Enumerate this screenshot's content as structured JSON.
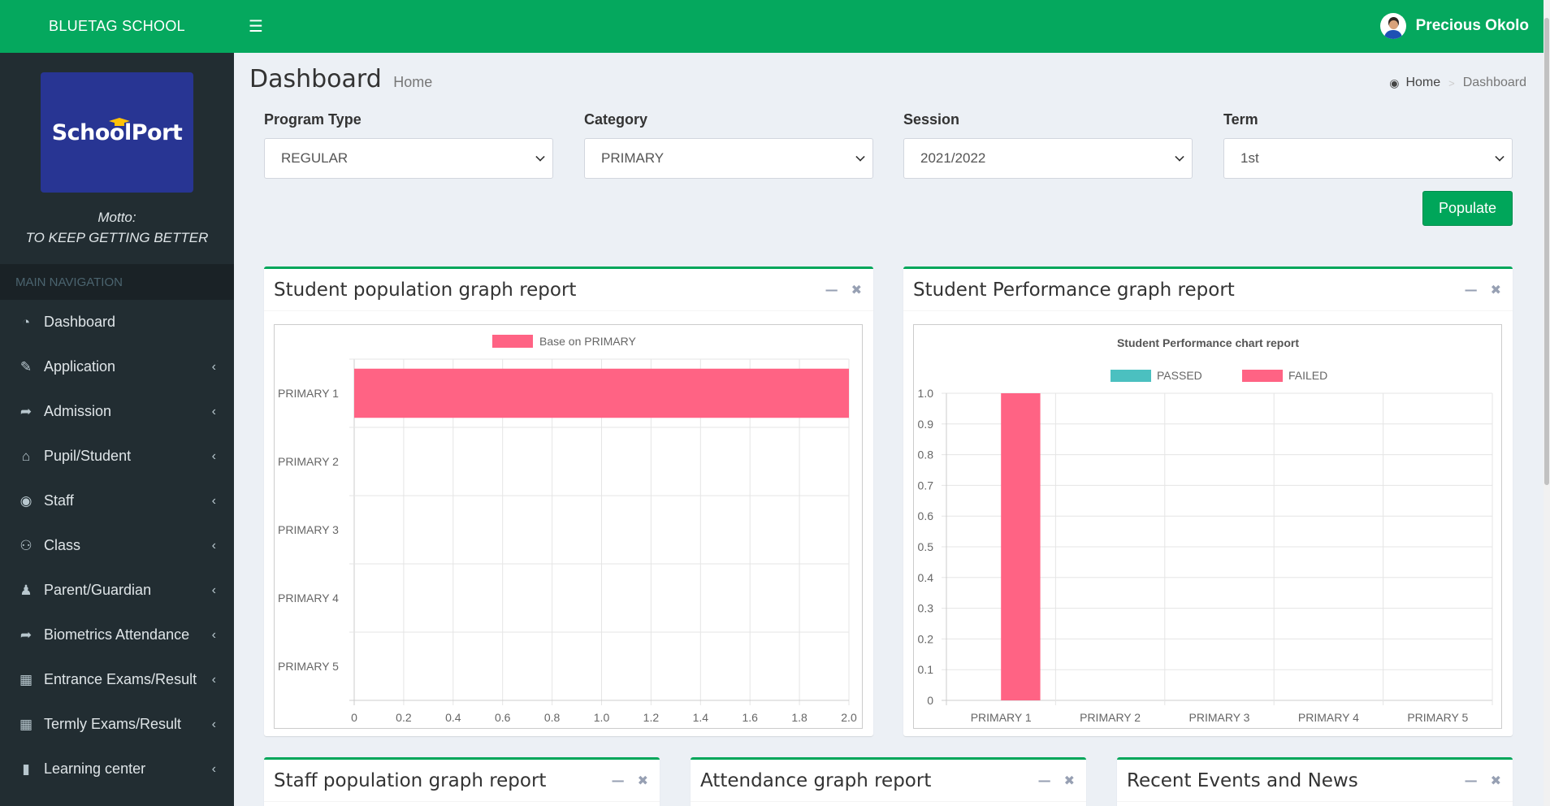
{
  "app": {
    "brand": "BLUETAG SCHOOL",
    "logo_text": "SchoolPort",
    "motto_label": "Motto:",
    "motto": "TO KEEP GETTING BETTER"
  },
  "header": {
    "user_name": "Precious Okolo"
  },
  "sidebar": {
    "section_title": "MAIN NAVIGATION",
    "items": [
      {
        "label": "Dashboard",
        "icon": "dashboard-icon",
        "expandable": false
      },
      {
        "label": "Application",
        "icon": "edit-icon",
        "expandable": true
      },
      {
        "label": "Admission",
        "icon": "share-icon",
        "expandable": true
      },
      {
        "label": "Pupil/Student",
        "icon": "graduation-cap-icon",
        "expandable": true
      },
      {
        "label": "Staff",
        "icon": "user-circle-icon",
        "expandable": true
      },
      {
        "label": "Class",
        "icon": "users-icon",
        "expandable": true
      },
      {
        "label": "Parent/Guardian",
        "icon": "user-icon",
        "expandable": true
      },
      {
        "label": "Biometrics Attendance",
        "icon": "share-icon",
        "expandable": true
      },
      {
        "label": "Entrance Exams/Result",
        "icon": "table-icon",
        "expandable": true
      },
      {
        "label": "Termly Exams/Result",
        "icon": "table-icon",
        "expandable": true
      },
      {
        "label": "Learning center",
        "icon": "book-icon",
        "expandable": true
      }
    ]
  },
  "page": {
    "title": "Dashboard",
    "subtitle": "Home",
    "breadcrumb": {
      "home": "Home",
      "current": "Dashboard"
    }
  },
  "filters": {
    "program_type": {
      "label": "Program Type",
      "value": "REGULAR"
    },
    "category": {
      "label": "Category",
      "value": "PRIMARY"
    },
    "session": {
      "label": "Session",
      "value": "2021/2022"
    },
    "term": {
      "label": "Term",
      "value": "1st"
    },
    "populate_label": "Populate"
  },
  "boxes": {
    "population": "Student population graph report",
    "performance": "Student Performance graph report",
    "staff": "Staff population graph report",
    "attendance": "Attendance graph report",
    "events": "Recent Events and News"
  },
  "colors": {
    "brand_green": "#05a85e",
    "sidebar_dark": "#222d32",
    "bar_pink": "#ff6384",
    "passed_teal": "#4bc0c0"
  },
  "chart_data": [
    {
      "type": "bar",
      "orientation": "horizontal",
      "title": "",
      "categories": [
        "PRIMARY 1",
        "PRIMARY 2",
        "PRIMARY 3",
        "PRIMARY 4",
        "PRIMARY 5"
      ],
      "series": [
        {
          "name": "Base on PRIMARY",
          "values": [
            2,
            0,
            0,
            0,
            0
          ],
          "color": "#ff6384"
        }
      ],
      "xlim": [
        0,
        2.0
      ],
      "xticks": [
        "0",
        "0.2",
        "0.4",
        "0.6",
        "0.8",
        "1.0",
        "1.2",
        "1.4",
        "1.6",
        "1.8",
        "2.0"
      ],
      "grid": true,
      "legend": "top"
    },
    {
      "type": "bar",
      "title": "Student Performance chart report",
      "categories": [
        "PRIMARY 1",
        "PRIMARY 2",
        "PRIMARY 3",
        "PRIMARY 4",
        "PRIMARY 5"
      ],
      "series": [
        {
          "name": "PASSED",
          "values": [
            0,
            0,
            0,
            0,
            0
          ],
          "color": "#4bc0c0"
        },
        {
          "name": "FAILED",
          "values": [
            1,
            0,
            0,
            0,
            0
          ],
          "color": "#ff6384"
        }
      ],
      "ylim": [
        0,
        1.0
      ],
      "yticks": [
        "0",
        "0.1",
        "0.2",
        "0.3",
        "0.4",
        "0.5",
        "0.6",
        "0.7",
        "0.8",
        "0.9",
        "1.0"
      ],
      "grid": true,
      "legend": "top"
    }
  ]
}
